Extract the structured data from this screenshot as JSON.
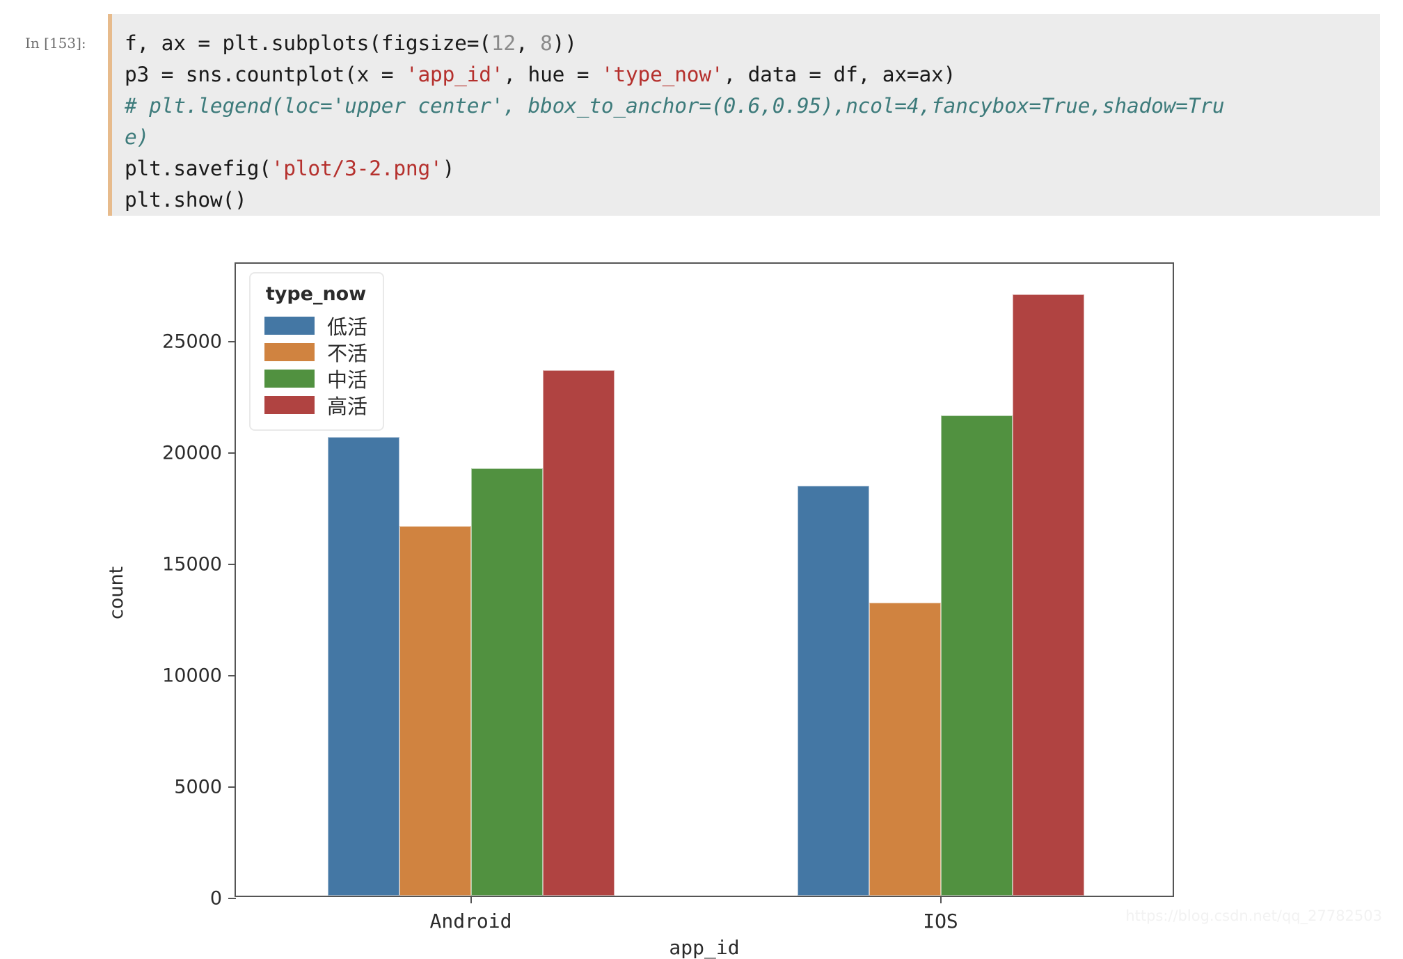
{
  "notebook": {
    "prompt": "In [153]:",
    "code_lines": [
      [
        {
          "t": "f, ax = plt.subplots(figsize=(",
          "c": "plain"
        },
        {
          "t": "12",
          "c": "num"
        },
        {
          "t": ", ",
          "c": "plain"
        },
        {
          "t": "8",
          "c": "num"
        },
        {
          "t": "))",
          "c": "plain"
        }
      ],
      [
        {
          "t": "p3 = sns.countplot(x = ",
          "c": "plain"
        },
        {
          "t": "'app_id'",
          "c": "str"
        },
        {
          "t": ", hue = ",
          "c": "plain"
        },
        {
          "t": "'type_now'",
          "c": "str"
        },
        {
          "t": ", data = df, ax=ax)",
          "c": "plain"
        }
      ],
      [
        {
          "t": "# plt.legend(loc='upper center', bbox_to_anchor=(0.6,0.95),ncol=4,fancybox=True,shadow=Tru",
          "c": "com"
        }
      ],
      [
        {
          "t": "e)",
          "c": "com"
        }
      ],
      [
        {
          "t": "plt.savefig(",
          "c": "plain"
        },
        {
          "t": "'plot/3-2.png'",
          "c": "str"
        },
        {
          "t": ")",
          "c": "plain"
        }
      ],
      [
        {
          "t": "plt.show()",
          "c": "plain"
        }
      ]
    ]
  },
  "chart_data": {
    "type": "bar",
    "title": "",
    "xlabel": "app_id",
    "ylabel": "count",
    "categories": [
      "Android",
      "IOS"
    ],
    "ylim": [
      0,
      28500
    ],
    "yticks": [
      0,
      5000,
      10000,
      15000,
      20000,
      25000
    ],
    "ytick_labels": [
      "0",
      "5000",
      "10000",
      "15000",
      "20000",
      "25000"
    ],
    "grid": false,
    "legend": {
      "title": "type_now",
      "position": "upper left",
      "entries": [
        "低活",
        "不活",
        "中活",
        "高活"
      ]
    },
    "series": [
      {
        "name": "低活",
        "color": "#4477a4",
        "values": [
          20600,
          18400
        ]
      },
      {
        "name": "不活",
        "color": "#d08340",
        "values": [
          16600,
          13150
        ]
      },
      {
        "name": "中活",
        "color": "#519140",
        "values": [
          19200,
          21550
        ]
      },
      {
        "name": "高活",
        "color": "#b04341",
        "values": [
          23600,
          27000
        ]
      }
    ]
  },
  "watermark": "https://blog.csdn.net/qq_27782503"
}
